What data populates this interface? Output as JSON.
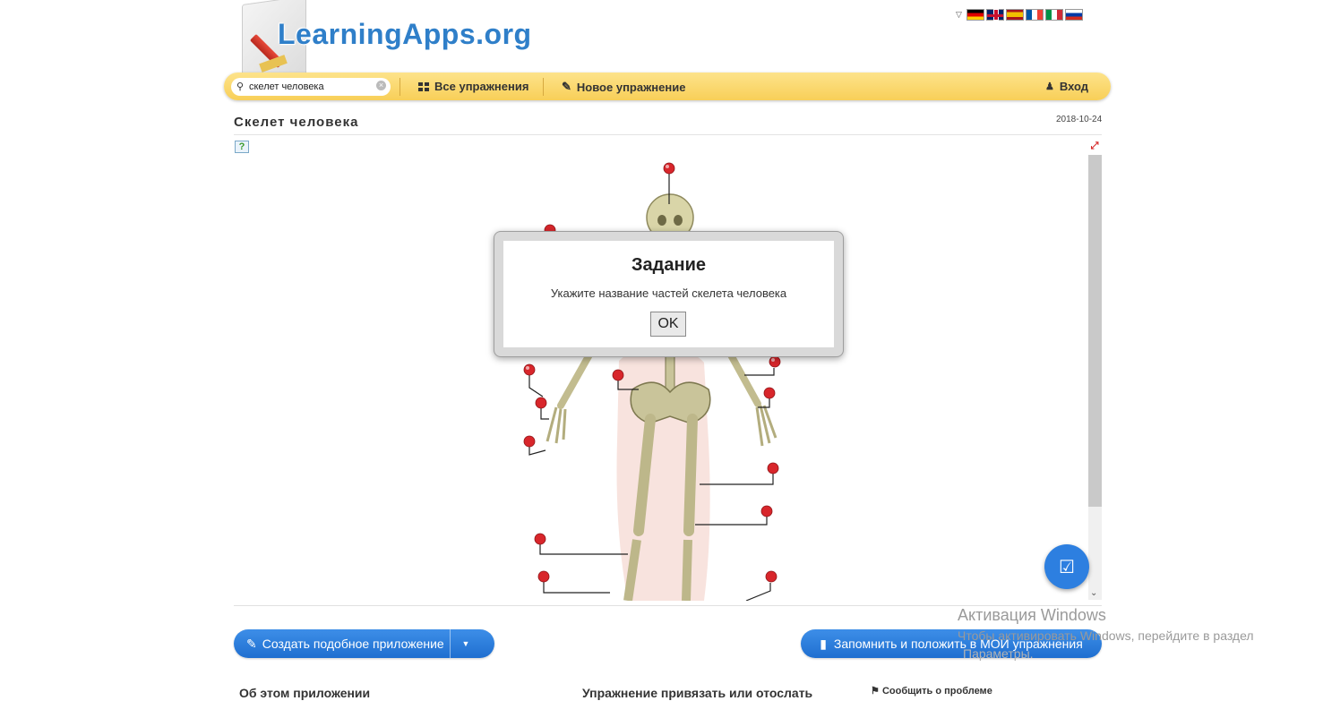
{
  "header": {
    "logo_text": "LearningApps.org",
    "languages": [
      "de",
      "gb",
      "es",
      "fr",
      "it",
      "ru"
    ]
  },
  "nav": {
    "search_value": "скелет человека",
    "all_exercises": "Все упражнения",
    "new_exercise": "Новое упражнение",
    "login": "Вход"
  },
  "page": {
    "title": "Скелет человека",
    "date": "2018-10-24"
  },
  "modal": {
    "title": "Задание",
    "text": "Укажите название частей скелета человека",
    "ok": "OK"
  },
  "actions": {
    "create_similar": "Создать подобное приложение",
    "save_to_my": "Запомнить и положить в МОИ упражнения"
  },
  "watermark": {
    "title": "Активация Windows",
    "subtitle": "Чтобы активировать Windows, перейдите в раздел",
    "subtitle2": "Параметры."
  },
  "footer": {
    "about": "Об этом приложении",
    "bind": "Упражнение привязать или отослать",
    "report": "Сообщить о проблеме"
  },
  "colors": {
    "nav_yellow": "#f8cf58",
    "accent_blue": "#1f6fd0",
    "pin_red": "#d8262b",
    "bone": "#c9c49a"
  },
  "icons": {
    "search": "search-icon",
    "grid": "grid-icon",
    "pencil": "pencil-icon",
    "user": "user-icon",
    "help": "help-icon",
    "fullscreen": "fullscreen-icon",
    "check": "check-icon",
    "edit": "edit-icon",
    "bookmark": "bookmark-icon",
    "flag": "flag-icon"
  }
}
